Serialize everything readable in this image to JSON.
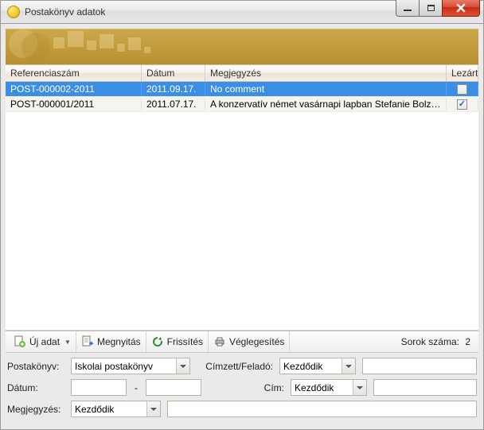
{
  "window": {
    "title": "Postakönyv adatok"
  },
  "columns": {
    "ref": "Referenciaszám",
    "date": "Dátum",
    "note": "Megjegyzés",
    "lock": "Lezárt"
  },
  "rows": [
    {
      "ref": "POST-000002-2011",
      "date": "2011.09.17.",
      "note": "No comment",
      "locked": false,
      "selected": true
    },
    {
      "ref": "POST-000001/2011",
      "date": "2011.07.17.",
      "note": "A konzervatív német vasárnapi lapban Stefanie Bolzen a Bef...",
      "locked": true,
      "selected": false
    }
  ],
  "toolbar": {
    "new": "Új adat",
    "open": "Megnyitás",
    "refresh": "Frissítés",
    "finalize": "Véglegesítés",
    "rowcount_label": "Sorok száma:",
    "rowcount_value": "2"
  },
  "filters": {
    "postbook_label": "Postakönyv:",
    "postbook_value": "Iskolai postakönyv",
    "recipient_label": "Címzett/Feladó:",
    "recipient_mode": "Kezdődik",
    "recipient_value": "",
    "date_label": "Dátum:",
    "date_from": "",
    "date_to": "",
    "address_label": "Cím:",
    "address_mode": "Kezdődik",
    "address_value": "",
    "note_label": "Megjegyzés:",
    "note_mode": "Kezdődik",
    "note_value": ""
  }
}
